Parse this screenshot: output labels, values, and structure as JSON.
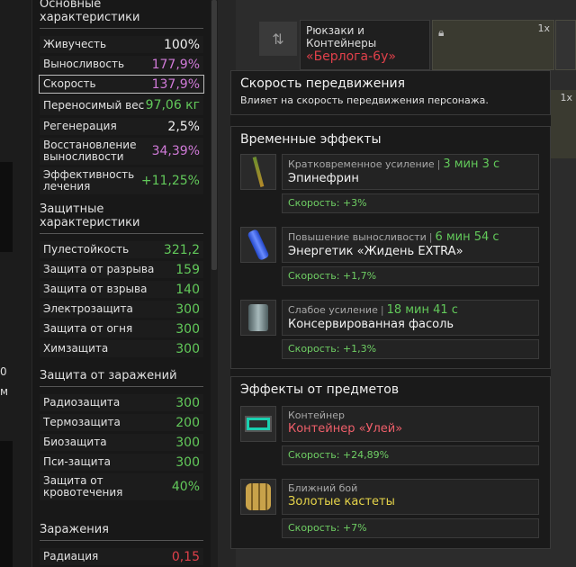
{
  "left_strip": {
    "texts": [
      "0",
      "м"
    ]
  },
  "stats": {
    "basic": {
      "title": "Основные характеристики",
      "rows": [
        {
          "label": "Живучесть",
          "value": "100%",
          "color": "#f0f0f0"
        },
        {
          "label": "Выносливость",
          "value": "177,9%",
          "color": "#d07ad8"
        },
        {
          "label": "Скорость",
          "value": "137,9%",
          "color": "#d07ad8"
        },
        {
          "label": "Переносимый вес",
          "value": "97,06 кг",
          "color": "#62c95a"
        },
        {
          "label": "Регенерация",
          "value": "2,5%",
          "color": "#f0f0f0"
        },
        {
          "label": "Восстановление выносливости",
          "value": "34,39%",
          "color": "#d07ad8"
        },
        {
          "label": "Эффективность лечения",
          "value": "+11,25%",
          "color": "#62c95a"
        }
      ]
    },
    "protection": {
      "title": "Защитные характеристики",
      "rows": [
        {
          "label": "Пулестойкость",
          "value": "321,2"
        },
        {
          "label": "Защита от разрыва",
          "value": "159"
        },
        {
          "label": "Защита от взрыва",
          "value": "140"
        },
        {
          "label": "Электрозащита",
          "value": "300"
        },
        {
          "label": "Защита от огня",
          "value": "300"
        },
        {
          "label": "Химзащита",
          "value": "300"
        }
      ]
    },
    "infection_protection": {
      "title": "Защита от заражений",
      "rows": [
        {
          "label": "Радиозащита",
          "value": "300"
        },
        {
          "label": "Термозащита",
          "value": "200"
        },
        {
          "label": "Биозащита",
          "value": "300"
        },
        {
          "label": "Пси-защита",
          "value": "300"
        },
        {
          "label": "Защита от кровотечения",
          "value": "40%"
        }
      ]
    },
    "infections": {
      "title": "Заражения",
      "rows": [
        {
          "label": "Радиация",
          "value": "0,15"
        }
      ]
    }
  },
  "inventory": {
    "item": {
      "category": "Рюкзаки и Контейнеры",
      "name": "«Берлога-6у»"
    },
    "slot_count_1": "1x",
    "slot_count_2": "1x"
  },
  "tooltip": {
    "title": "Скорость передвижения",
    "description": "Влияет на скорость передвижения персонажа.",
    "temp_title": "Временные эффекты",
    "temp_effects": [
      {
        "type": "Кратковременное усиление",
        "time": "3 мин 3 с",
        "name": "Эпинефрин",
        "bonus": "Скорость: +3%",
        "icon": "syringe-icon"
      },
      {
        "type": "Повышение выносливости",
        "time": "6 мин 54 с",
        "name": "Энергетик «Жидень EXTRA»",
        "bonus": "Скорость: +1,7%",
        "icon": "energy-drink-icon"
      },
      {
        "type": "Слабое усиление",
        "time": "18 мин 41 с",
        "name": "Консервированная фасоль",
        "bonus": "Скорость: +1,3%",
        "icon": "canned-beans-icon"
      }
    ],
    "item_title": "Эффекты от предметов",
    "item_effects": [
      {
        "type": "Контейнер",
        "name": "Контейнер «Улей»",
        "bonus": "Скорость: +24,89%",
        "icon": "container-icon",
        "name_color": "#ef5f6a"
      },
      {
        "type": "Ближний бой",
        "name": "Золотые кастеты",
        "bonus": "Скорость: +7%",
        "icon": "brass-knuckles-icon",
        "name_color": "#e6d44a"
      }
    ]
  }
}
